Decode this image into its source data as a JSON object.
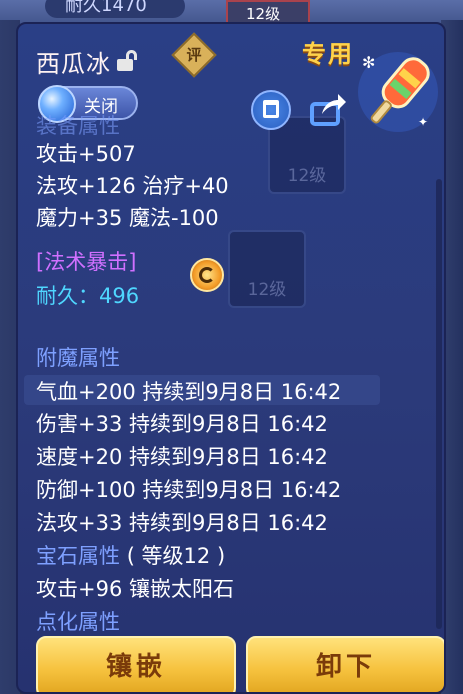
{
  "background": {
    "top_pill_text": "耐久1470",
    "top_slot_text": "12级",
    "ghost_slot_a": "12级",
    "ghost_slot_b": "12级",
    "ghost_slot_c_label": "珍"
  },
  "tooltip": {
    "item_name": "西瓜冰",
    "rate_badge": "评",
    "exclusive_label": "专用",
    "close_button": "关闭",
    "equip_attr_title": "装备属性",
    "base_stats": [
      "攻击+507",
      "法攻+126 治疗+40",
      "魔力+35 魔法-100"
    ],
    "special_skill": "[法术暴击]",
    "durability": "耐久：496",
    "enchant_title": "附魔属性",
    "enchant_stats": [
      "气血+200 持续到9月8日 16:42",
      "伤害+33 持续到9月8日 16:42",
      "速度+20 持续到9月8日 16:42",
      "防御+100 持续到9月8日 16:42",
      "法攻+33 持续到9月8日 16:42"
    ],
    "gem_title": "宝石属性",
    "gem_level": "( 等级12 )",
    "gem_stat": "攻击+96 镶嵌太阳石",
    "refine_title": "点化属性",
    "inlay_button": "镶嵌",
    "unequip_button": "卸下"
  },
  "colors": {
    "section_title": "#7ea0ff",
    "durability": "#4fd7ff",
    "special": "#d070ff",
    "exclusive": "#ffd24a",
    "button_gold": "#f6c23e"
  },
  "icons": {
    "lock": "lock-icon",
    "rate": "rate-badge-icon",
    "item": "popsicle-icon",
    "close": "close-orb-icon",
    "scroll": "scroll-icon",
    "share": "share-icon",
    "effect": "spin-effect-icon"
  }
}
